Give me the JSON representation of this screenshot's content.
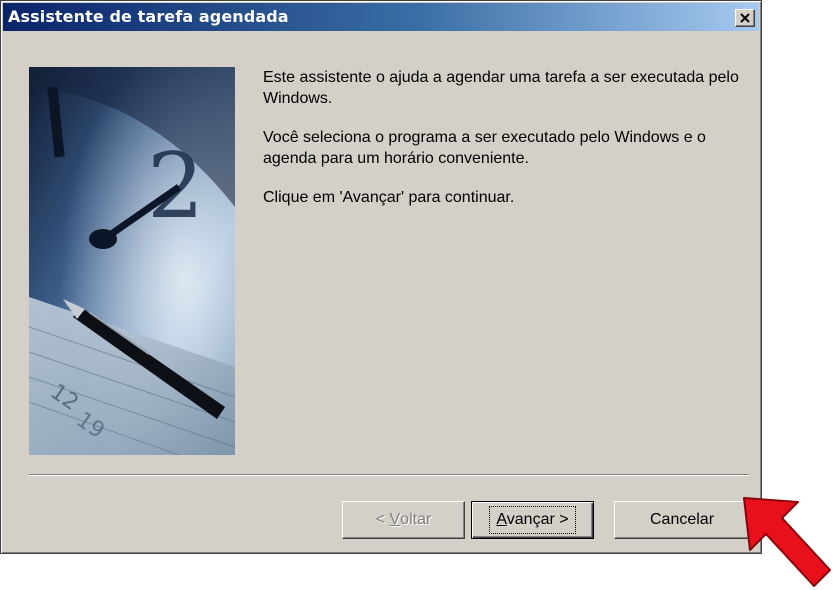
{
  "window": {
    "title": "Assistente de tarefa agendada",
    "close_label": "Close"
  },
  "content": {
    "paragraph1": "Este assistente o ajuda a agendar uma tarefa a ser executada pelo Windows.",
    "paragraph2": "Você seleciona o programa a ser executado pelo Windows e o agenda para um horário conveniente.",
    "paragraph3": "Clique em 'Avançar' para continuar."
  },
  "buttons": {
    "back": {
      "prefix": "< ",
      "accel": "V",
      "rest": "oltar",
      "enabled": false
    },
    "next": {
      "accel": "A",
      "rest": "vançar >",
      "default": true
    },
    "cancel": {
      "label": "Cancelar"
    }
  },
  "side_image": {
    "icon": "clock-and-pen-illustration"
  },
  "annotation": {
    "icon": "red-arrow-pointer",
    "color": "#e8101a"
  },
  "colors": {
    "titlebar_start": "#0a246a",
    "titlebar_end": "#a6caf0",
    "dialog_face": "#d4d0c8"
  }
}
